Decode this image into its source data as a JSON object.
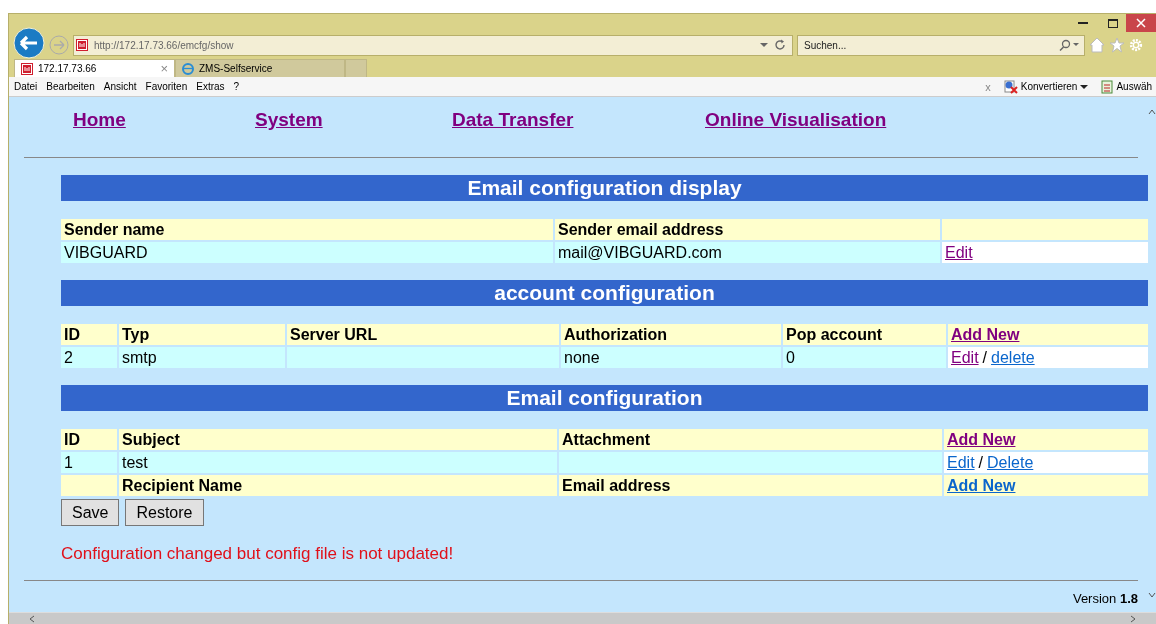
{
  "browser": {
    "url_host": "http://172.17.73.66",
    "url_path": "/emcfg/show",
    "search": {
      "placeholder": "Suchen..."
    },
    "tabs": [
      {
        "label": "172.17.73.66",
        "selected": true,
        "close": "×"
      },
      {
        "label": "ZMS-Selfservice",
        "selected": false
      }
    ],
    "menu": [
      "Datei",
      "Bearbeiten",
      "Ansicht",
      "Favoriten",
      "Extras",
      "?"
    ],
    "toolbar_close": "x",
    "toolbar": [
      "Konvertieren",
      "Auswäh"
    ]
  },
  "nav": [
    {
      "label": "Home",
      "visited": true
    },
    {
      "label": "System",
      "visited": true
    },
    {
      "label": "Data Transfer",
      "visited": true
    },
    {
      "label": "Online Visualisation",
      "visited": true
    }
  ],
  "sections": [
    {
      "title": "Email configuration display",
      "rows": [
        {
          "kind": "header",
          "cells": [
            {
              "text": "Sender name"
            },
            {
              "text": "Sender email address"
            },
            {}
          ]
        },
        {
          "kind": "data",
          "cells": [
            {
              "text": "VIBGUARD"
            },
            {
              "text": "mail@VIBGUARD.com"
            },
            {
              "links": [
                {
                  "label": "Edit",
                  "visited": true
                }
              ]
            }
          ]
        }
      ]
    },
    {
      "title": "account configuration",
      "rows": [
        {
          "kind": "header",
          "cells": [
            {
              "text": "ID"
            },
            {
              "text": "Typ"
            },
            {
              "text": "Server URL"
            },
            {
              "text": "Authorization"
            },
            {
              "text": "Pop account"
            },
            {
              "links": [
                {
                  "label": "Add New",
                  "visited": true
                }
              ]
            }
          ]
        },
        {
          "kind": "data",
          "cells": [
            {
              "text": "2"
            },
            {
              "text": "smtp"
            },
            {},
            {
              "text": "none"
            },
            {
              "text": "0"
            },
            {
              "links": [
                {
                  "label": "Edit",
                  "visited": true
                },
                {
                  "label": "delete",
                  "visited": false
                }
              ],
              "separator": "/"
            }
          ]
        }
      ]
    },
    {
      "title": "Email configuration",
      "rows": [
        {
          "kind": "header",
          "cells": [
            {
              "text": "ID"
            },
            {
              "text": "Subject"
            },
            {
              "text": "Attachment"
            },
            {
              "links": [
                {
                  "label": "Add New",
                  "visited": true
                }
              ]
            }
          ]
        },
        {
          "kind": "data",
          "cells": [
            {
              "text": "1"
            },
            {
              "text": "test"
            },
            {},
            {
              "links": [
                {
                  "label": "Edit",
                  "visited": false
                },
                {
                  "label": "Delete",
                  "visited": false
                }
              ],
              "separator": "/"
            }
          ]
        },
        {
          "kind": "header",
          "cells": [
            {},
            {
              "text": "Recipient Name"
            },
            {
              "text": "Email address"
            },
            {
              "links": [
                {
                  "label": "Add New",
                  "visited": false
                }
              ]
            }
          ]
        }
      ]
    }
  ],
  "buttons": [
    "Save",
    "Restore"
  ],
  "message": "Configuration changed but config file is not updated!",
  "version": "Version **1.8**"
}
